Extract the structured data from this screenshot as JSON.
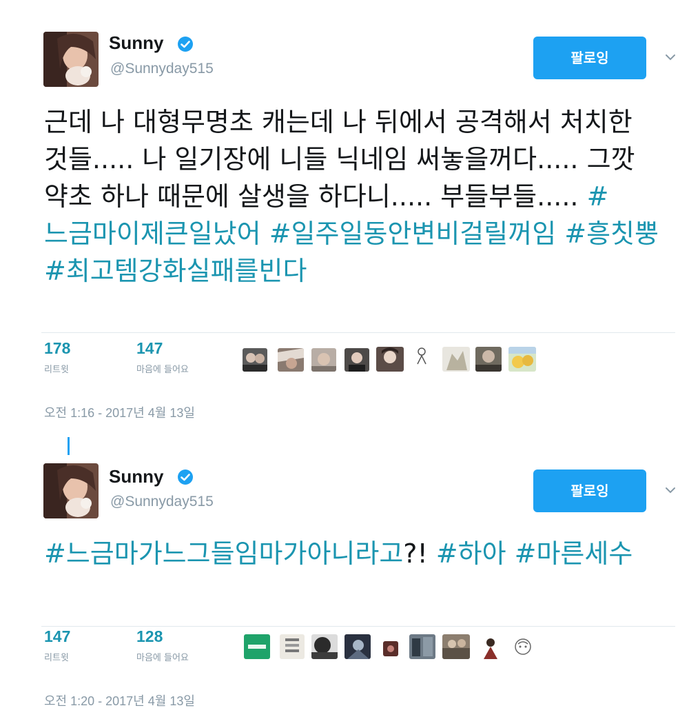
{
  "tweets": [
    {
      "author": {
        "name": "Sunny",
        "handle": "@Sunnyday515",
        "verified": true
      },
      "follow_label": "팔로잉",
      "body_text": "근데 나 대형무명초 캐는데 나 뒤에서 공격해서 처치한 것들..... 나 일기장에 니들 닉네임 써놓을꺼다..... 그깟 약초 하나 때문에 살생을 하다니..... 부들부들..... ",
      "hashtags": [
        "#느금마이제큰일났어",
        "#일주일동안변비걸릴꺼임",
        "#흥칫뿡",
        "#최고템강화실패를빈다"
      ],
      "stats": [
        {
          "value": "178",
          "label": "리트윗"
        },
        {
          "value": "147",
          "label": "마음에 들어요"
        }
      ],
      "timestamp": "오전 1:16 - 2017년 4월 13일"
    },
    {
      "author": {
        "name": "Sunny",
        "handle": "@Sunnyday515",
        "verified": true
      },
      "follow_label": "팔로잉",
      "hashtags": [
        "#느금마가느그들임마가아니라고",
        "#하아",
        "#마른세수"
      ],
      "inline_text": "?! ",
      "stats": [
        {
          "value": "147",
          "label": "리트윗"
        },
        {
          "value": "128",
          "label": "마음에 들어요"
        }
      ],
      "timestamp": "오전 1:20 - 2017년 4월 13일"
    }
  ],
  "colors": {
    "accent": "#1da1f2",
    "hashtag": "#1b95b0",
    "muted": "#8899a6",
    "text": "#14171a"
  },
  "icons": [
    "verified-badge-icon",
    "chevron-down-icon"
  ]
}
